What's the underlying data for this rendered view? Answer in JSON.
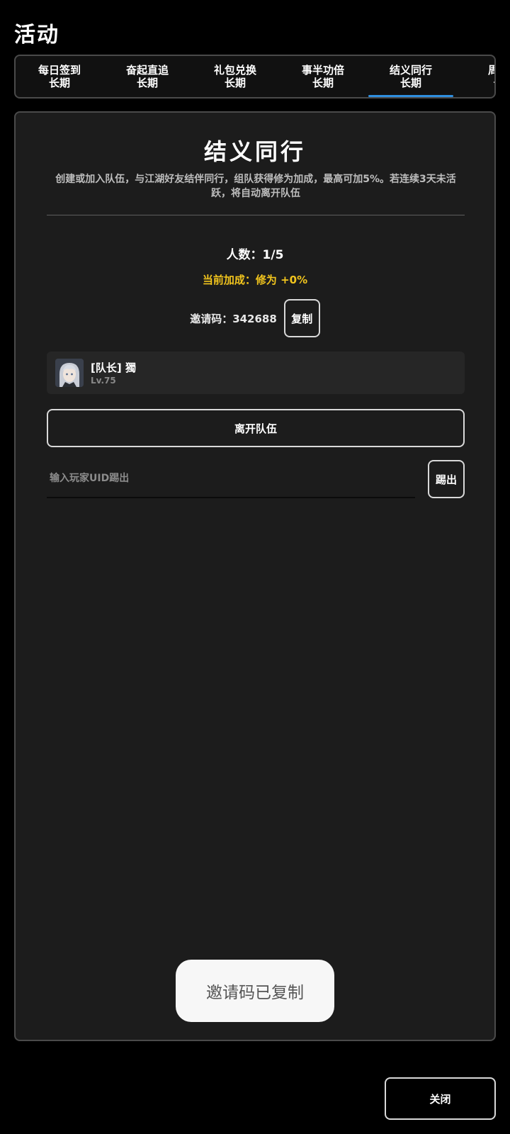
{
  "header": {
    "title": "活动"
  },
  "tabs": [
    {
      "name": "每日签到",
      "sub": "长期"
    },
    {
      "name": "奋起直追",
      "sub": "长期"
    },
    {
      "name": "礼包兑换",
      "sub": "长期"
    },
    {
      "name": "事半功倍",
      "sub": "长期"
    },
    {
      "name": "结义同行",
      "sub": "长期"
    },
    {
      "name": "周常",
      "sub": "长"
    }
  ],
  "active_tab_index": 4,
  "accent_color": "#2f8fe0",
  "bonus_color": "#f2c51d",
  "panel": {
    "title": "结义同行",
    "description": "创建或加入队伍，与江湖好友结伴同行，组队获得修为加成，最高可加5%。若连续3天未活跃，将自动离开队伍",
    "members_count": "人数：1/5",
    "bonus": "当前加成：修为 +0%",
    "invite_label": "邀请码：342688",
    "copy_label": "复制",
    "member": {
      "role": "[队长]",
      "name": "獨",
      "level": "Lv.75",
      "avatar_icon": "character-avatar-icon"
    },
    "leave_label": "离开队伍",
    "kick_placeholder": "输入玩家UID踢出",
    "kick_value": "",
    "kick_label": "踢出"
  },
  "toast": {
    "text": "邀请码已复制"
  },
  "footer": {
    "close_label": "关闭"
  }
}
